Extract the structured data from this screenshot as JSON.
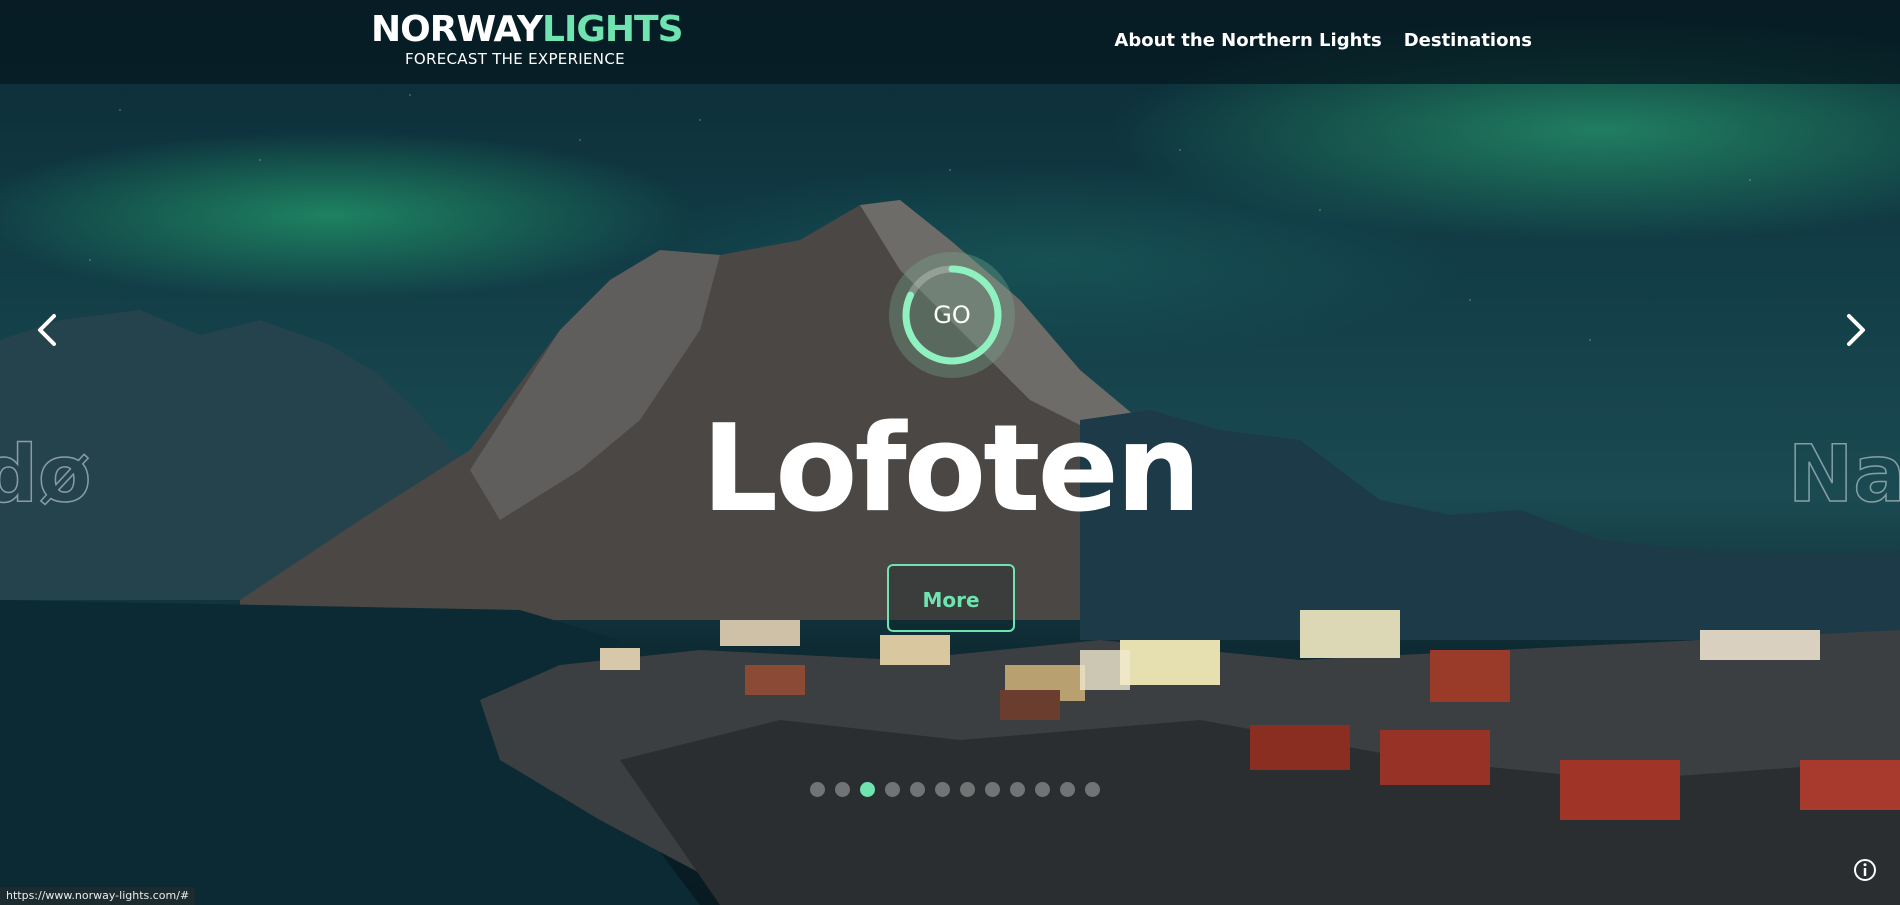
{
  "header": {
    "logo_part1": "NORWAY",
    "logo_part2": "LIGHTS",
    "tagline": "FORECAST THE EXPERIENCE",
    "nav": [
      {
        "label": "About the Northern Lights"
      },
      {
        "label": "Destinations"
      }
    ]
  },
  "slider": {
    "go_label": "GO",
    "title": "Lofoten",
    "prev_ghost": "dø",
    "next_ghost": "Na",
    "more_label": "More",
    "dot_count": 12,
    "active_dot": 3,
    "go_progress": 0.82,
    "prev_icon": "chevron-left-icon",
    "next_icon": "chevron-right-icon"
  },
  "status": {
    "url": "https://www.norway-lights.com/#"
  },
  "colors": {
    "accent": "#6fe3b0",
    "header_bg": "#06181e"
  }
}
